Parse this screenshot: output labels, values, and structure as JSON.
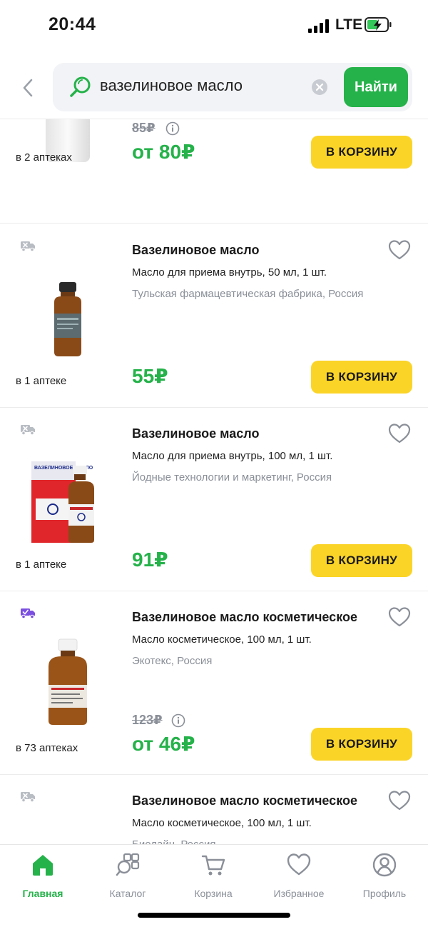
{
  "status": {
    "time": "20:44",
    "network": "LTE"
  },
  "search": {
    "query": "вазелиновое масло",
    "button": "Найти"
  },
  "products": [
    {
      "title": "",
      "desc": "",
      "maker": "",
      "stock": "в 2 аптеках",
      "old_price": "85₽",
      "price": "от 80₽",
      "cart": "В КОРЗИНУ"
    },
    {
      "title": "Вазелиновое масло",
      "desc": "Масло для приема внутрь, 50 мл, 1 шт.",
      "maker": "Тульская фармацевтическая фабрика, Россия",
      "stock": "в 1 аптеке",
      "price": "55₽",
      "cart": "В КОРЗИНУ"
    },
    {
      "title": "Вазелиновое масло",
      "desc": "Масло для приема внутрь, 100 мл, 1 шт.",
      "maker": "Йодные технологии и маркетинг, Россия",
      "stock": "в 1 аптеке",
      "price": "91₽",
      "cart": "В КОРЗИНУ",
      "box_text": "ВАЗЕЛИНОВОЕ МАСЛО"
    },
    {
      "title": "Вазелиновое масло косметическое",
      "desc": "Масло косметическое, 100 мл, 1 шт.",
      "maker": "Экотекс, Россия",
      "stock": "в 73 аптеках",
      "old_price": "123₽",
      "price": "от 46₽",
      "cart": "В КОРЗИНУ"
    },
    {
      "title": "Вазелиновое масло косметическое",
      "desc": "Масло косметическое, 100 мл, 1 шт.",
      "maker": "Биолайн, Россия"
    }
  ],
  "tabs": [
    {
      "label": "Главная",
      "icon": "home-icon"
    },
    {
      "label": "Каталог",
      "icon": "catalog-icon"
    },
    {
      "label": "Корзина",
      "icon": "cart-icon"
    },
    {
      "label": "Избранное",
      "icon": "heart-icon"
    },
    {
      "label": "Профиль",
      "icon": "profile-icon"
    }
  ],
  "colors": {
    "accent": "#25b24a",
    "cart_button": "#fbd428",
    "muted": "#8a8f98",
    "delivery_active": "#7b4fe0"
  }
}
